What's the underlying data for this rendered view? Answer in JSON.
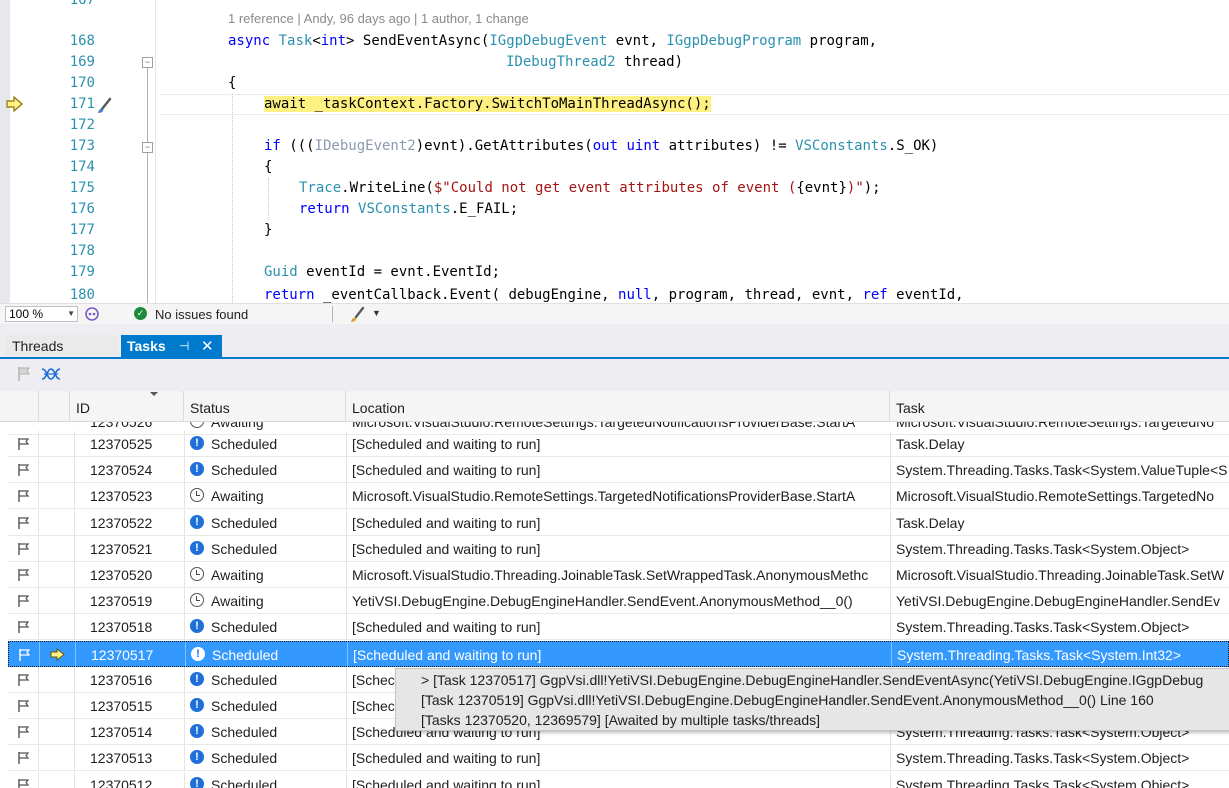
{
  "editor": {
    "lines": [
      {
        "n": "167"
      },
      {
        "n": "168"
      },
      {
        "n": "169"
      },
      {
        "n": "170"
      },
      {
        "n": "171"
      },
      {
        "n": "172"
      },
      {
        "n": "173"
      },
      {
        "n": "174"
      },
      {
        "n": "175"
      },
      {
        "n": "176"
      },
      {
        "n": "177"
      },
      {
        "n": "178"
      },
      {
        "n": "179"
      },
      {
        "n": "180"
      }
    ],
    "codelens": "1 reference | Andy, 96 days ago | 1 author, 1 change",
    "code": {
      "l168_kw": "async",
      "l168_ty": "Task",
      "l168_a": "<",
      "l168_kw2": "int",
      "l168_b": "> SendEventAsync(",
      "l168_ty2": "IGgpDebugEvent",
      "l168_c": " evnt, ",
      "l168_ty3": "IGgpDebugProgram",
      "l168_d": " program,",
      "l169_ty": "IDebugThread2",
      "l169_a": " thread)",
      "l170": "{",
      "l171": "await _taskContext.Factory.SwitchToMainThreadAsync();",
      "l173_kw": "if",
      "l173_a": " (((",
      "l173_ty": "IDebugEvent2",
      "l173_b": ")evnt).GetAttributes(",
      "l173_kw2": "out",
      "l173_kw3": "uint",
      "l173_c": " attributes) != ",
      "l173_ty2": "VSConstants",
      "l173_d": ".S_OK)",
      "l174": "{",
      "l175_ty": "Trace",
      "l175_a": ".WriteLine(",
      "l175_str": "$\"Could not get event attributes of event (",
      "l175_b": "{evnt}",
      "l175_str2": ")\"",
      "l175_c": ");",
      "l176_kw": "return",
      "l176_ty": "VSConstants",
      "l176_a": ".E_FAIL;",
      "l177": "}",
      "l179_ty": "Guid",
      "l179_a": " eventId = evnt.EventId;",
      "l180_kw": "return",
      "l180_a": " _eventCallback.Event( debugEngine, ",
      "l180_kw2": "null",
      "l180_b": ", program, thread, evnt, ",
      "l180_kw3": "ref",
      "l180_c": " eventId,"
    }
  },
  "status_bar": {
    "zoom": "100 %",
    "issues": "No issues found"
  },
  "tabs": [
    {
      "label": "Threads"
    },
    {
      "label": "Tasks"
    }
  ],
  "grid": {
    "columns": [
      "ID",
      "Status",
      "Location",
      "Task"
    ],
    "partial_top": {
      "id": "12370526",
      "status": "Awaiting",
      "location": "Microsoft.VisualStudio.RemoteSettings.TargetedNotificationsProviderBase.StartA",
      "task": "Microsoft.VisualStudio.RemoteSettings.TargetedNo"
    },
    "rows": [
      {
        "id": "12370525",
        "status": "Scheduled",
        "location": "[Scheduled and waiting to run]",
        "task": "Task.Delay"
      },
      {
        "id": "12370524",
        "status": "Scheduled",
        "location": "[Scheduled and waiting to run]",
        "task": "System.Threading.Tasks.Task<System.ValueTuple<S"
      },
      {
        "id": "12370523",
        "status": "Awaiting",
        "location": "Microsoft.VisualStudio.RemoteSettings.TargetedNotificationsProviderBase.StartA",
        "task": "Microsoft.VisualStudio.RemoteSettings.TargetedNo"
      },
      {
        "id": "12370522",
        "status": "Scheduled",
        "location": "[Scheduled and waiting to run]",
        "task": "Task.Delay"
      },
      {
        "id": "12370521",
        "status": "Scheduled",
        "location": "[Scheduled and waiting to run]",
        "task": "System.Threading.Tasks.Task<System.Object>"
      },
      {
        "id": "12370520",
        "status": "Awaiting",
        "location": "Microsoft.VisualStudio.Threading.JoinableTask.SetWrappedTask.AnonymousMethc",
        "task": "Microsoft.VisualStudio.Threading.JoinableTask.SetW"
      },
      {
        "id": "12370519",
        "status": "Awaiting",
        "location": "YetiVSI.DebugEngine.DebugEngineHandler.SendEvent.AnonymousMethod__0()",
        "task": "YetiVSI.DebugEngine.DebugEngineHandler.SendEv"
      },
      {
        "id": "12370518",
        "status": "Scheduled",
        "location": "[Scheduled and waiting to run]",
        "task": "System.Threading.Tasks.Task<System.Object>"
      },
      {
        "id": "12370517",
        "status": "Scheduled",
        "location": "[Scheduled and waiting to run]",
        "task": "System.Threading.Tasks.Task<System.Int32>"
      },
      {
        "id": "12370516",
        "status": "Scheduled",
        "location": "[Schec",
        "task": ""
      },
      {
        "id": "12370515",
        "status": "Scheduled",
        "location": "[Schec",
        "task": ""
      },
      {
        "id": "12370514",
        "status": "Scheduled",
        "location": "[Scheduled and waiting to run]",
        "task": "System.Threading.Tasks.Task<System.Object>"
      },
      {
        "id": "12370513",
        "status": "Scheduled",
        "location": "[Scheduled and waiting to run]",
        "task": "System.Threading.Tasks.Task<System.Object>"
      },
      {
        "id": "12370512",
        "status": "Scheduled",
        "location": "[Scheduled and waiting to run]",
        "task": "System.Threading.Tasks.Task<System.Object>"
      }
    ]
  },
  "tooltip": {
    "lines": [
      "> [Task 12370517] GgpVsi.dll!YetiVSI.DebugEngine.DebugEngineHandler.SendEventAsync(YetiVSI.DebugEngine.IGgpDebug",
      "[Task 12370519] GgpVsi.dll!YetiVSI.DebugEngine.DebugEngineHandler.SendEvent.AnonymousMethod__0() Line 160",
      "[Tasks 12370520, 12369579] [Awaited by multiple tasks/threads]"
    ]
  },
  "colors": {
    "accent": "#007acc",
    "selection": "#3399ff",
    "current_line": "#fff181",
    "scheduled_icon": "#1e6fd9"
  }
}
